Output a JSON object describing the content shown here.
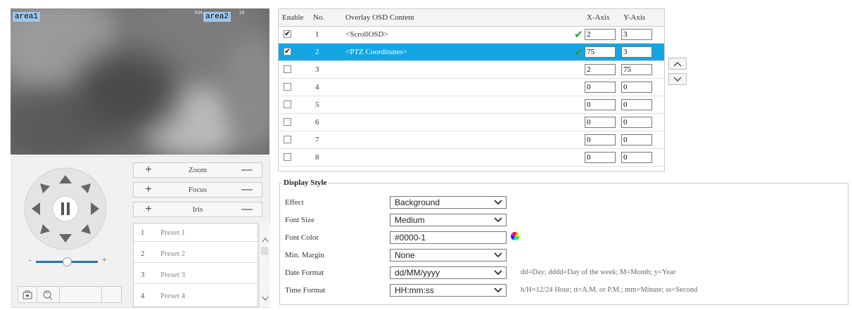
{
  "video": {
    "area1_label": "area1",
    "area2_label": "area2",
    "area2_left_tag": "P24",
    "area2_right_tag": "20"
  },
  "ptz": {
    "zoom_label": "Zoom",
    "focus_label": "Focus",
    "iris_label": "Iris",
    "plus_symbol": "+",
    "minus_symbol": "—",
    "speed_minus": "-",
    "speed_plus": "+",
    "presets": [
      {
        "num": "1",
        "label": "Preset 1"
      },
      {
        "num": "2",
        "label": "Preset 2"
      },
      {
        "num": "3",
        "label": "Preset 3"
      },
      {
        "num": "4",
        "label": "Preset 4"
      }
    ]
  },
  "osd_table": {
    "headers": {
      "enable": "Enable",
      "no": "No.",
      "content": "Overlay OSD Content",
      "x": "X-Axis",
      "y": "Y-Axis"
    },
    "rows": [
      {
        "no": "1",
        "checked": true,
        "content": "<ScrollOSD>",
        "valid": true,
        "x": "2",
        "y": "3"
      },
      {
        "no": "2",
        "checked": true,
        "content": "<PTZ Coordinates>",
        "valid": true,
        "x": "75",
        "y": "3"
      },
      {
        "no": "3",
        "checked": false,
        "content": "",
        "valid": false,
        "x": "2",
        "y": "75"
      },
      {
        "no": "4",
        "checked": false,
        "content": "",
        "valid": false,
        "x": "0",
        "y": "0"
      },
      {
        "no": "5",
        "checked": false,
        "content": "",
        "valid": false,
        "x": "0",
        "y": "0"
      },
      {
        "no": "6",
        "checked": false,
        "content": "",
        "valid": false,
        "x": "0",
        "y": "0"
      },
      {
        "no": "7",
        "checked": false,
        "content": "",
        "valid": false,
        "x": "0",
        "y": "0"
      },
      {
        "no": "8",
        "checked": false,
        "content": "",
        "valid": false,
        "x": "0",
        "y": "0"
      }
    ],
    "selected_row": 2,
    "check_glyph": "✔",
    "valid_glyph": "✔"
  },
  "display_style": {
    "title": "Display Style",
    "effect": {
      "label": "Effect",
      "value": "Background"
    },
    "font_size": {
      "label": "Font Size",
      "value": "Medium"
    },
    "font_color": {
      "label": "Font Color",
      "value": "#0000-1"
    },
    "min_margin": {
      "label": "Min. Margin",
      "value": "None"
    },
    "date_format": {
      "label": "Date Format",
      "value": "dd/MM/yyyy",
      "hint": "dd=Day; dddd=Day of the week; M=Month; y=Year"
    },
    "time_format": {
      "label": "Time Format",
      "value": "HH:mm:ss",
      "hint": "h/H=12/24 Hour; tt=A.M. or P.M.; mm=Minute; ss=Second"
    }
  },
  "colors": {
    "selected_row": "#15a5e3",
    "valid_check": "#2f9a2f",
    "area_label_bg": "#9fc6ea"
  },
  "icons": {
    "move_up": "chevron-up-icon",
    "move_down": "chevron-down-icon",
    "color_picker": "color-wheel-icon"
  }
}
